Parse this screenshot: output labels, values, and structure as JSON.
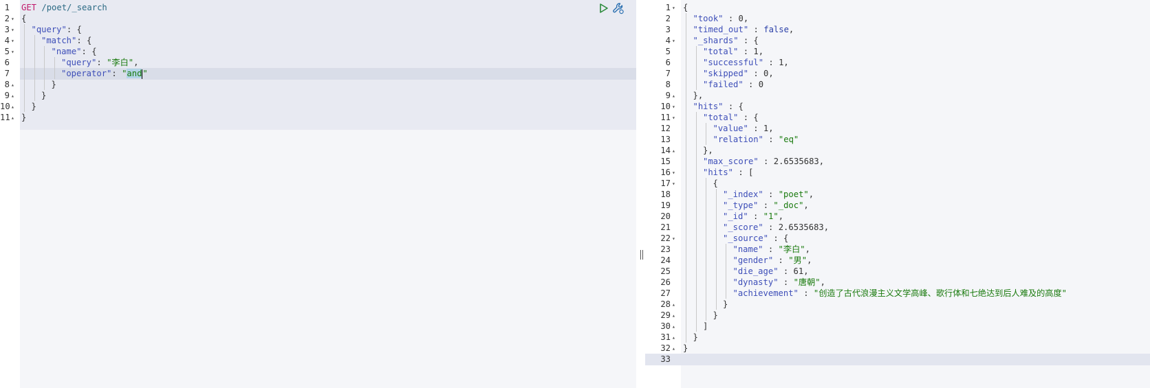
{
  "request": {
    "method": "GET",
    "path": "/poet/_search",
    "lines": [
      {
        "n": "1",
        "fold": "",
        "indent": 0,
        "tokens": [
          [
            "m",
            "GET"
          ],
          [
            "n",
            " "
          ],
          [
            "p",
            "/poet/_search"
          ]
        ]
      },
      {
        "n": "2",
        "fold": "▾",
        "indent": 0,
        "tokens": [
          [
            "n",
            "{"
          ]
        ]
      },
      {
        "n": "3",
        "fold": "▾",
        "indent": 1,
        "tokens": [
          [
            "k",
            "\"query\""
          ],
          [
            "n",
            ": {"
          ]
        ]
      },
      {
        "n": "4",
        "fold": "▾",
        "indent": 2,
        "tokens": [
          [
            "k",
            "\"match\""
          ],
          [
            "n",
            ": {"
          ]
        ]
      },
      {
        "n": "5",
        "fold": "▾",
        "indent": 3,
        "tokens": [
          [
            "k",
            "\"name\""
          ],
          [
            "n",
            ": {"
          ]
        ]
      },
      {
        "n": "6",
        "fold": "",
        "indent": 4,
        "tokens": [
          [
            "k",
            "\"query\""
          ],
          [
            "n",
            ": "
          ],
          [
            "s",
            "\"李白\""
          ],
          [
            "n",
            ","
          ]
        ]
      },
      {
        "n": "7",
        "fold": "",
        "indent": 4,
        "tokens": [
          [
            "k",
            "\"operator\""
          ],
          [
            "n",
            ": "
          ],
          [
            "s",
            "\""
          ],
          [
            "sel",
            "and"
          ],
          [
            "cur",
            ""
          ],
          [
            "s",
            "\""
          ]
        ]
      },
      {
        "n": "8",
        "fold": "▴",
        "indent": 3,
        "tokens": [
          [
            "n",
            "}"
          ]
        ]
      },
      {
        "n": "9",
        "fold": "▴",
        "indent": 2,
        "tokens": [
          [
            "n",
            "}"
          ]
        ]
      },
      {
        "n": "10",
        "fold": "▴",
        "indent": 1,
        "tokens": [
          [
            "n",
            "}"
          ]
        ]
      },
      {
        "n": "11",
        "fold": "▴",
        "indent": 0,
        "tokens": [
          [
            "n",
            "}"
          ]
        ]
      }
    ]
  },
  "response": {
    "lines": [
      {
        "n": "1",
        "fold": "▾",
        "indent": 0,
        "tokens": [
          [
            "n",
            "{"
          ]
        ]
      },
      {
        "n": "2",
        "fold": "",
        "indent": 1,
        "tokens": [
          [
            "k",
            "\"took\""
          ],
          [
            "n",
            " : 0,"
          ]
        ]
      },
      {
        "n": "3",
        "fold": "",
        "indent": 1,
        "tokens": [
          [
            "k",
            "\"timed_out\""
          ],
          [
            "n",
            " : "
          ],
          [
            "kw",
            "false"
          ],
          [
            "n",
            ","
          ]
        ]
      },
      {
        "n": "4",
        "fold": "▾",
        "indent": 1,
        "tokens": [
          [
            "k",
            "\"_shards\""
          ],
          [
            "n",
            " : {"
          ]
        ]
      },
      {
        "n": "5",
        "fold": "",
        "indent": 2,
        "tokens": [
          [
            "k",
            "\"total\""
          ],
          [
            "n",
            " : 1,"
          ]
        ]
      },
      {
        "n": "6",
        "fold": "",
        "indent": 2,
        "tokens": [
          [
            "k",
            "\"successful\""
          ],
          [
            "n",
            " : 1,"
          ]
        ]
      },
      {
        "n": "7",
        "fold": "",
        "indent": 2,
        "tokens": [
          [
            "k",
            "\"skipped\""
          ],
          [
            "n",
            " : 0,"
          ]
        ]
      },
      {
        "n": "8",
        "fold": "",
        "indent": 2,
        "tokens": [
          [
            "k",
            "\"failed\""
          ],
          [
            "n",
            " : 0"
          ]
        ]
      },
      {
        "n": "9",
        "fold": "▴",
        "indent": 1,
        "tokens": [
          [
            "n",
            "},"
          ]
        ]
      },
      {
        "n": "10",
        "fold": "▾",
        "indent": 1,
        "tokens": [
          [
            "k",
            "\"hits\""
          ],
          [
            "n",
            " : {"
          ]
        ]
      },
      {
        "n": "11",
        "fold": "▾",
        "indent": 2,
        "tokens": [
          [
            "k",
            "\"total\""
          ],
          [
            "n",
            " : {"
          ]
        ]
      },
      {
        "n": "12",
        "fold": "",
        "indent": 3,
        "tokens": [
          [
            "k",
            "\"value\""
          ],
          [
            "n",
            " : 1,"
          ]
        ]
      },
      {
        "n": "13",
        "fold": "",
        "indent": 3,
        "tokens": [
          [
            "k",
            "\"relation\""
          ],
          [
            "n",
            " : "
          ],
          [
            "s",
            "\"eq\""
          ]
        ]
      },
      {
        "n": "14",
        "fold": "▴",
        "indent": 2,
        "tokens": [
          [
            "n",
            "},"
          ]
        ]
      },
      {
        "n": "15",
        "fold": "",
        "indent": 2,
        "tokens": [
          [
            "k",
            "\"max_score\""
          ],
          [
            "n",
            " : 2.6535683,"
          ]
        ]
      },
      {
        "n": "16",
        "fold": "▾",
        "indent": 2,
        "tokens": [
          [
            "k",
            "\"hits\""
          ],
          [
            "n",
            " : ["
          ]
        ]
      },
      {
        "n": "17",
        "fold": "▾",
        "indent": 3,
        "tokens": [
          [
            "n",
            "{"
          ]
        ]
      },
      {
        "n": "18",
        "fold": "",
        "indent": 4,
        "tokens": [
          [
            "k",
            "\"_index\""
          ],
          [
            "n",
            " : "
          ],
          [
            "s",
            "\"poet\""
          ],
          [
            "n",
            ","
          ]
        ]
      },
      {
        "n": "19",
        "fold": "",
        "indent": 4,
        "tokens": [
          [
            "k",
            "\"_type\""
          ],
          [
            "n",
            " : "
          ],
          [
            "s",
            "\"_doc\""
          ],
          [
            "n",
            ","
          ]
        ]
      },
      {
        "n": "20",
        "fold": "",
        "indent": 4,
        "tokens": [
          [
            "k",
            "\"_id\""
          ],
          [
            "n",
            " : "
          ],
          [
            "s",
            "\"1\""
          ],
          [
            "n",
            ","
          ]
        ]
      },
      {
        "n": "21",
        "fold": "",
        "indent": 4,
        "tokens": [
          [
            "k",
            "\"_score\""
          ],
          [
            "n",
            " : 2.6535683,"
          ]
        ]
      },
      {
        "n": "22",
        "fold": "▾",
        "indent": 4,
        "tokens": [
          [
            "k",
            "\"_source\""
          ],
          [
            "n",
            " : {"
          ]
        ]
      },
      {
        "n": "23",
        "fold": "",
        "indent": 5,
        "tokens": [
          [
            "k",
            "\"name\""
          ],
          [
            "n",
            " : "
          ],
          [
            "s",
            "\"李白\""
          ],
          [
            "n",
            ","
          ]
        ]
      },
      {
        "n": "24",
        "fold": "",
        "indent": 5,
        "tokens": [
          [
            "k",
            "\"gender\""
          ],
          [
            "n",
            " : "
          ],
          [
            "s",
            "\"男\""
          ],
          [
            "n",
            ","
          ]
        ]
      },
      {
        "n": "25",
        "fold": "",
        "indent": 5,
        "tokens": [
          [
            "k",
            "\"die_age\""
          ],
          [
            "n",
            " : 61,"
          ]
        ]
      },
      {
        "n": "26",
        "fold": "",
        "indent": 5,
        "tokens": [
          [
            "k",
            "\"dynasty\""
          ],
          [
            "n",
            " : "
          ],
          [
            "s",
            "\"唐朝\""
          ],
          [
            "n",
            ","
          ]
        ]
      },
      {
        "n": "27",
        "fold": "",
        "indent": 5,
        "tokens": [
          [
            "k",
            "\"achievement\""
          ],
          [
            "n",
            " : "
          ],
          [
            "s",
            "\"创造了古代浪漫主义文学高峰、歌行体和七绝达到后人难及的高度\""
          ]
        ]
      },
      {
        "n": "28",
        "fold": "▴",
        "indent": 4,
        "tokens": [
          [
            "n",
            "}"
          ]
        ]
      },
      {
        "n": "29",
        "fold": "▴",
        "indent": 3,
        "tokens": [
          [
            "n",
            "}"
          ]
        ]
      },
      {
        "n": "30",
        "fold": "▴",
        "indent": 2,
        "tokens": [
          [
            "n",
            "]"
          ]
        ]
      },
      {
        "n": "31",
        "fold": "▴",
        "indent": 1,
        "tokens": [
          [
            "n",
            "}"
          ]
        ]
      },
      {
        "n": "32",
        "fold": "▴",
        "indent": 0,
        "tokens": [
          [
            "n",
            "}"
          ]
        ]
      },
      {
        "n": "33",
        "fold": "",
        "indent": 0,
        "tokens": []
      }
    ]
  },
  "toolbar": {
    "run_icon": "play-icon",
    "settings_icon": "wrench-icon"
  },
  "colors": {
    "key": "#3d4eb8",
    "string": "#197a0d",
    "method": "#c0186a",
    "path": "#2b6a84"
  }
}
